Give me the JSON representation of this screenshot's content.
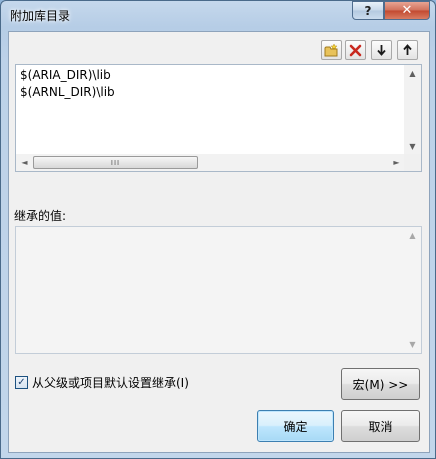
{
  "window": {
    "title": "附加库目录"
  },
  "titlebar": {
    "help_label": "?",
    "close_label": "✕"
  },
  "toolbar": {
    "buttons": [
      {
        "name": "new-line",
        "icon": "new-folder-icon"
      },
      {
        "name": "delete",
        "icon": "delete-x-icon"
      },
      {
        "name": "move-down",
        "icon": "arrow-down-icon"
      },
      {
        "name": "move-up",
        "icon": "arrow-up-icon"
      }
    ]
  },
  "directories": {
    "items": [
      "$(ARIA_DIR)\\lib",
      "$(ARNL_DIR)\\lib"
    ]
  },
  "scrollbar": {
    "thumb_grip": "III",
    "up": "▲",
    "down": "▼",
    "left": "◄",
    "right": "►"
  },
  "inherited": {
    "label": "继承的值:",
    "items": []
  },
  "options": {
    "inherit_checkbox_label": "从父级或项目默认设置继承(I)",
    "inherit_checked": true
  },
  "buttons": {
    "macro": "宏(M) >>",
    "ok": "确定",
    "cancel": "取消"
  },
  "colors": {
    "close_button": "#c2482f",
    "default_button_border": "#3c7fb1",
    "delete_icon": "#c8281e"
  }
}
